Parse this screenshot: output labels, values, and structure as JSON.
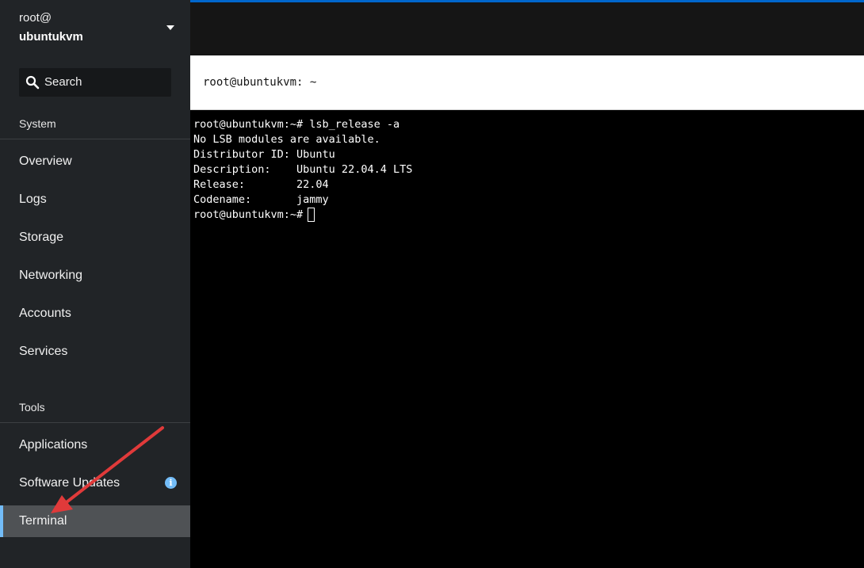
{
  "sidebar": {
    "host": {
      "user": "root@",
      "name": "ubuntukvm"
    },
    "search": {
      "label": "Search"
    },
    "sections": {
      "system": "System",
      "tools": "Tools"
    },
    "system_items": [
      "Overview",
      "Logs",
      "Storage",
      "Networking",
      "Accounts",
      "Services"
    ],
    "tools_items": [
      "Applications",
      "Software Updates",
      "Terminal"
    ],
    "info_badge": "i"
  },
  "terminal": {
    "title": "root@ubuntukvm: ~",
    "lines": [
      "root@ubuntukvm:~# lsb_release -a",
      "No LSB modules are available.",
      "Distributor ID: Ubuntu",
      "Description:    Ubuntu 22.04.4 LTS",
      "Release:        22.04",
      "Codename:       jammy",
      "root@ubuntukvm:~# "
    ]
  },
  "colors": {
    "sidebar_bg": "#212427",
    "active_item_bg": "#4f5255",
    "accent": "#73bcf7",
    "top_strip": "#0066cc",
    "annotation_arrow": "#e03a3a"
  },
  "icons": {
    "search": "search-icon",
    "caret": "caret-down-icon",
    "info": "info-icon"
  }
}
